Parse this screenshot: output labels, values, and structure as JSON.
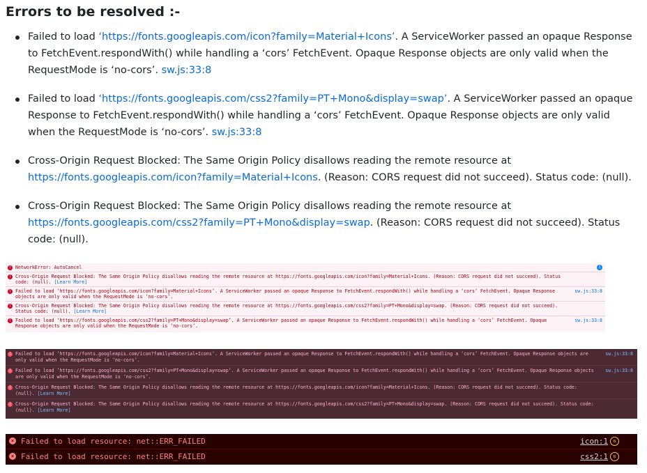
{
  "heading": "Errors to be resolved :-",
  "errors": [
    {
      "pre": "Failed to load ",
      "link": "‘https://fonts.googleapis.com/icon?family=Material+Icons’",
      "post": ". A ServiceWorker passed an opaque Response to FetchEvent.respondWith() while handling a ‘cors’ FetchEvent. Opaque Response objects are only valid when the RequestMode is ‘no-cors’. ",
      "loc": "sw.js:33:8"
    },
    {
      "pre": "Failed to load ",
      "link": "‘https://fonts.googleapis.com/css2?family=PT+Mono&display=swap’",
      "post": ". A ServiceWorker passed an opaque Response to FetchEvent.respondWith() while handling a ‘cors’ FetchEvent. Opaque Response objects are only valid when the RequestMode is ‘no-cors’. ",
      "loc": "sw.js:33:8"
    },
    {
      "pre": "Cross-Origin Request Blocked: The Same Origin Policy disallows reading the remote resource at ",
      "link": "https://fonts.googleapis.com/icon?family=Material+Icons",
      "post": ". (Reason: CORS request did not succeed). Status code: (null).",
      "loc": ""
    },
    {
      "pre": "Cross-Origin Request Blocked: The Same Origin Policy disallows reading the remote resource at ",
      "link": "https://fonts.googleapis.com/css2?family=PT+Mono&display=swap",
      "post": ". (Reason: CORS request did not succeed). Status code: (null).",
      "loc": ""
    }
  ],
  "console_light": {
    "badge": "i",
    "rows": [
      {
        "text": "NetworkError: AutoCancel",
        "loc": "",
        "extra": ""
      },
      {
        "text": "Cross-Origin Request Blocked: The Same Origin Policy disallows reading the remote resource at https://fonts.googleapis.com/icon?family=Material+Icons. (Reason: CORS request did not succeed). Status code: (null).",
        "loc": "",
        "extra": "[Learn More]"
      },
      {
        "text": "Failed to load ‘https://fonts.googleapis.com/icon?family=Material+Icons’. A ServiceWorker passed an opaque Response to FetchEvent.respondWith() while handling a ‘cors’ FetchEvent. Opaque Response objects are only valid when the RequestMode is ‘no-cors’.",
        "loc": "sw.js:33:8",
        "extra": ""
      },
      {
        "text": "Cross-Origin Request Blocked: The Same Origin Policy disallows reading the remote resource at https://fonts.googleapis.com/css2?family=PT+Mono&display=swap. (Reason: CORS request did not succeed). Status code: (null).",
        "loc": "",
        "extra": "[Learn More]"
      },
      {
        "text": "Failed to load ‘https://fonts.googleapis.com/css2?family=PT+Mono&display=swap’. A ServiceWorker passed an opaque Response to FetchEvent.respondWith() while handling a ‘cors’ FetchEvent. Opaque Response objects are only valid when the RequestMode is ‘no-cors’.",
        "loc": "sw.js:33:8",
        "extra": ""
      }
    ]
  },
  "console_dark": {
    "rows": [
      {
        "text": "Failed to load ‘https://fonts.googleapis.com/icon?family=Material+Icons’. A ServiceWorker passed an opaque Response to FetchEvent.respondWith() while handling a ‘cors’ FetchEvent. Opaque Response objects are only valid when the RequestMode is ‘no-cors’.",
        "loc": "sw.js:33:8",
        "extra": ""
      },
      {
        "text": "Failed to load ‘https://fonts.googleapis.com/css2?family=PT+Mono&display=swap’. A ServiceWorker passed an opaque Response to FetchEvent.respondWith() while handling a ‘cors’ FetchEvent. Opaque Response objects are only valid when the RequestMode is ‘no-cors’.",
        "loc": "sw.js:33:8",
        "extra": ""
      },
      {
        "text": "Cross-Origin Request Blocked: The Same Origin Policy disallows reading the remote resource at https://fonts.googleapis.com/icon?family=Material+Icons. (Reason: CORS request did not succeed). Status code: (null).",
        "loc": "",
        "extra": "[Learn More]"
      },
      {
        "text": "Cross-Origin Request Blocked: The Same Origin Policy disallows reading the remote resource at https://fonts.googleapis.com/css2?family=PT+Mono&display=swap. (Reason: CORS request did not succeed). Status code: (null).",
        "loc": "",
        "extra": "[Learn More]"
      }
    ]
  },
  "console_chrome": {
    "rows": [
      {
        "text": "Failed to load resource: net::ERR_FAILED",
        "loc": "icon:1"
      },
      {
        "text": "Failed to load resource: net::ERR_FAILED",
        "loc": "css2:1"
      }
    ]
  }
}
